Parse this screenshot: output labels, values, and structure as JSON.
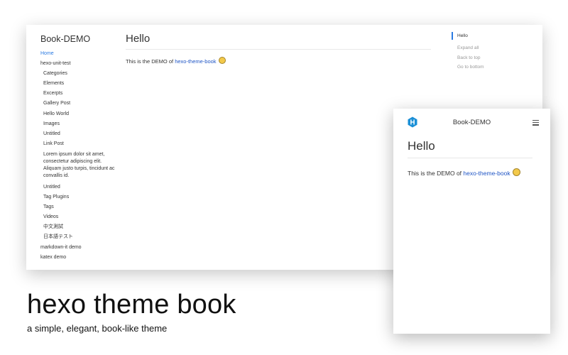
{
  "desktop": {
    "brand": "Book-DEMO",
    "nav": [
      {
        "label": "Home",
        "level": 0,
        "active": true
      },
      {
        "label": "hexo-unit-test",
        "level": 0
      },
      {
        "label": "Categories",
        "level": 1
      },
      {
        "label": "Elements",
        "level": 1
      },
      {
        "label": "Excerpts",
        "level": 1
      },
      {
        "label": "Gallery Post",
        "level": 1
      },
      {
        "label": "Hello World",
        "level": 1
      },
      {
        "label": "Images",
        "level": 1
      },
      {
        "label": "Untitled",
        "level": 1
      },
      {
        "label": "Link Post",
        "level": 1
      },
      {
        "label": "Lorem ipsum dolor sit amet, consectetur adipiscing elit. Aliquam justo turpis, tincidunt ac convallis id.",
        "level": 1,
        "multiline": true
      },
      {
        "label": "Untitled",
        "level": 1
      },
      {
        "label": "Tag Plugins",
        "level": 1
      },
      {
        "label": "Tags",
        "level": 1
      },
      {
        "label": "Videos",
        "level": 1
      },
      {
        "label": "中文測試",
        "level": 1
      },
      {
        "label": "日本語テスト",
        "level": 1
      },
      {
        "label": "markdown-it demo",
        "level": 0
      },
      {
        "label": "katex demo",
        "level": 0
      }
    ],
    "page_title": "Hello",
    "body_prefix": "This is the DEMO of ",
    "body_link": "hexo-theme-book",
    "toc": {
      "active": "Hello",
      "links": [
        "Expand all",
        "Back to top",
        "Go to bottom"
      ]
    }
  },
  "mobile": {
    "logo_icon": "hexo-logo-icon",
    "brand": "Book-DEMO",
    "menu_icon": "hamburger-menu-icon",
    "page_title": "Hello",
    "body_prefix": "This is the DEMO of ",
    "body_link": "hexo-theme-book"
  },
  "headline": "hexo theme book",
  "tagline": "a simple, elegant, book-like theme",
  "colors": {
    "accent": "#2a7ae2",
    "link": "#1f55c5",
    "logo": "#1a8fd6"
  }
}
